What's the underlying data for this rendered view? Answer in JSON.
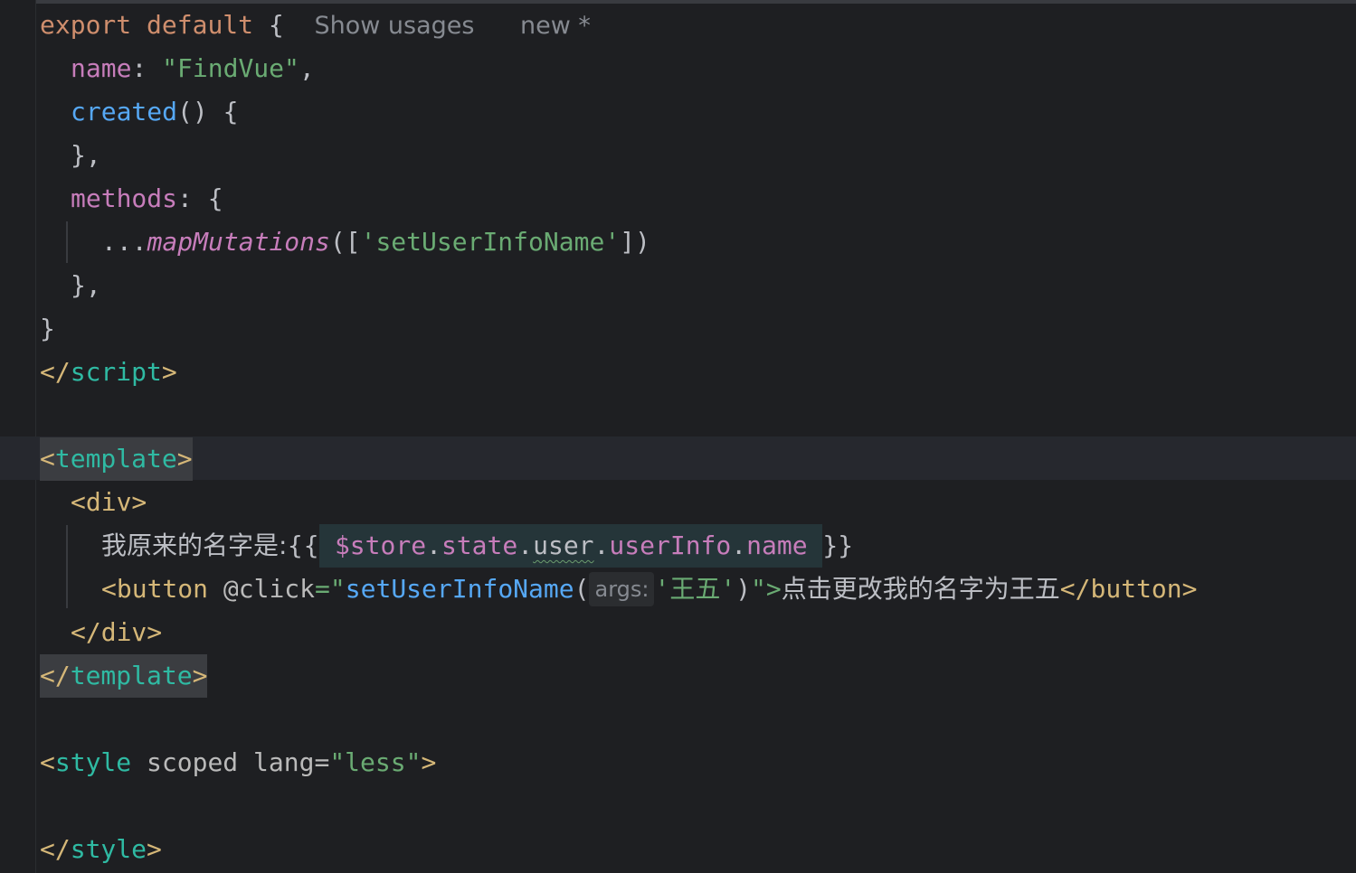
{
  "editor": {
    "hint_usages": "Show usages",
    "hint_new": "new *",
    "code": {
      "l1_export": "export",
      "l1_default": "default",
      "l1_brace": " {",
      "l2_name_key": "name",
      "l2_colon": ": ",
      "l2_name_val": "\"FindVue\"",
      "l2_comma": ",",
      "l3_created": "created",
      "l3_rest": "() {",
      "l4": "},",
      "l5_methods": "methods",
      "l5_rest": ": {",
      "l6_spread": "...",
      "l6_fn": "mapMutations",
      "l6_open": "([",
      "l6_str": "'setUserInfoName'",
      "l6_close": "])",
      "l7": "},",
      "l8": "}",
      "l9_open": "</",
      "l9_tag": "script",
      "l9_close": ">",
      "l11_open": "<",
      "l11_tag": "template",
      "l11_close": ">",
      "l12": "<div>",
      "l13_text": "我原来的名字是:{{",
      "l13_store": "$store",
      "l13_dot1": ".",
      "l13_state": "state",
      "l13_dot2": ".",
      "l13_user": "user",
      "l13_dot3": ".",
      "l13_userinfo": "userInfo",
      "l13_dot4": ".",
      "l13_name": "name",
      "l13_end": "}}",
      "l14_btn_open": "<button",
      "l14_attr": "@click",
      "l14_eq": "=\"",
      "l14_fn": "setUserInfoName",
      "l14_paren": "(",
      "l14_hint": "args:",
      "l14_arg": "'王五'",
      "l14_close_paren": ")",
      "l14_quote_gt": "\">",
      "l14_text": "点击更改我的名字为王五",
      "l14_btn_close": "</button>",
      "l15": "</div>",
      "l16_open": "</",
      "l16_tag": "template",
      "l16_close": ">",
      "l18_open": "<",
      "l18_tag": "style",
      "l18_scoped": "scoped",
      "l18_lang": "lang",
      "l18_eq": "=",
      "l18_val": "\"less\"",
      "l18_close": ">",
      "l20_open": "</",
      "l20_tag": "style",
      "l20_close": ">"
    }
  }
}
